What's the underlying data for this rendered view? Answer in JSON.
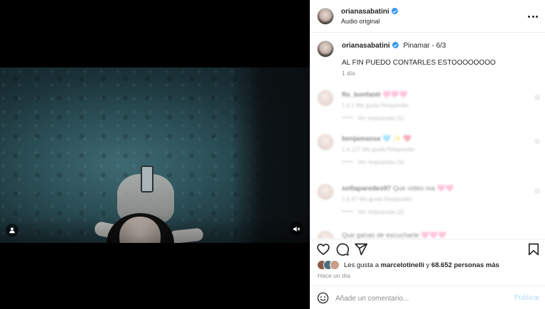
{
  "header": {
    "username": "orianasabatini",
    "audio": "Audio original"
  },
  "caption": {
    "username": "orianasabatini",
    "location": "Pinamar - 6/3",
    "text": "AL FIN PUEDO CONTARLES ESTOOOOOOOO",
    "time": "1 día"
  },
  "comments": [
    {
      "user": "flo_bonfanti",
      "text": "🩷🩷🩷",
      "meta": "1 d   1 Me gusta   Responder",
      "replies": "Ver respuestas (1)"
    },
    {
      "user": "benjamassa",
      "text": "🩵 ✨ 💖",
      "meta": "1 d   127 Me gusta   Responder",
      "replies": "Ver respuestas (4)"
    },
    {
      "user": "sofiaparedes97",
      "text": "Que video ma 🩷🩷",
      "meta": "1 d   47 Me gusta   Responder",
      "replies": "Ver respuestas (2)"
    },
    {
      "user": "",
      "text": "Que ganas de escucharte 🩷🩷🩷",
      "meta": "",
      "replies": ""
    }
  ],
  "likes": {
    "prefix": "Les gusta a",
    "user": "marcelotinelli",
    "connector": "y",
    "others": "68.652 personas más"
  },
  "post_time": "Hace un día",
  "comment_box": {
    "placeholder": "Añade un comentario...",
    "publish_label": "Publicar"
  },
  "colors": {
    "verified": "#3897f0",
    "publish_disabled": "#b3dbff",
    "secondary_text": "#8e8e8e"
  },
  "icons": {
    "like": "heart-icon",
    "comment": "speech-bubble-icon",
    "share": "paper-plane-icon",
    "save": "bookmark-icon",
    "more": "ellipsis-icon",
    "emoji": "smiley-icon",
    "mute": "speaker-muted-icon",
    "tag": "user-tag-icon"
  }
}
